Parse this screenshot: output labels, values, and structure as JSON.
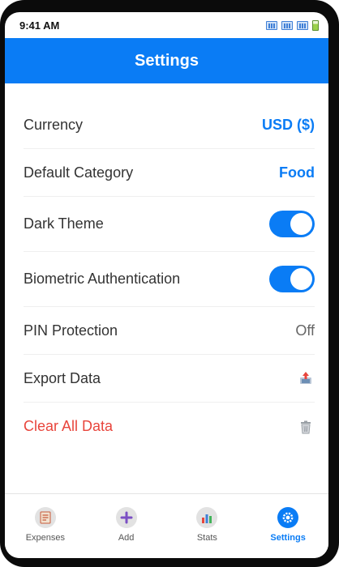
{
  "status_bar": {
    "time": "9:41 AM"
  },
  "header": {
    "title": "Settings"
  },
  "settings": {
    "currency": {
      "label": "Currency",
      "value": "USD ($)"
    },
    "default_category": {
      "label": "Default Category",
      "value": "Food"
    },
    "dark_theme": {
      "label": "Dark Theme",
      "enabled": true
    },
    "biometric": {
      "label": "Biometric Authentication",
      "enabled": true
    },
    "pin": {
      "label": "PIN Protection",
      "value": "Off"
    },
    "export": {
      "label": "Export Data",
      "icon": "export-icon"
    },
    "clear": {
      "label": "Clear All Data",
      "icon": "trash-icon"
    }
  },
  "tabs": [
    {
      "label": "Expenses",
      "icon": "receipt-icon",
      "active": false
    },
    {
      "label": "Add",
      "icon": "plus-icon",
      "active": false
    },
    {
      "label": "Stats",
      "icon": "bar-chart-icon",
      "active": false
    },
    {
      "label": "Settings",
      "icon": "gear-icon",
      "active": true
    }
  ],
  "colors": {
    "accent": "#0a7cf5",
    "danger": "#e8453c"
  }
}
